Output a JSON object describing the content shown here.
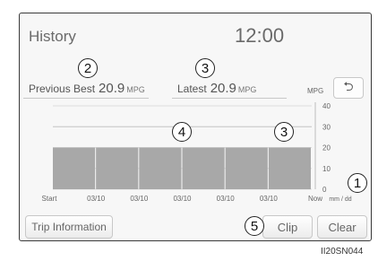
{
  "screen": {
    "title": "History",
    "clock": "12:00"
  },
  "stats": {
    "previous_best": {
      "label": "Previous Best",
      "value": "20.9",
      "unit": "MPG"
    },
    "latest": {
      "label": "Latest",
      "value": "20.9",
      "unit": "MPG"
    }
  },
  "chart_data": {
    "type": "bar",
    "categories": [
      "03/10",
      "03/10",
      "03/10",
      "03/10",
      "03/10"
    ],
    "values": [
      20,
      20,
      20,
      20,
      20,
      20
    ],
    "start_label": "Start",
    "end_label": "Now",
    "xlabel": "mm / dd",
    "ylabel": "MPG",
    "yticks": [
      0,
      10,
      20,
      30,
      40
    ],
    "ylim": [
      0,
      40
    ],
    "bar_color": "#a8a8a8",
    "guide_value": 30
  },
  "buttons": {
    "back_icon": "return-arrow-icon",
    "trip_info": "Trip Information",
    "clip": "Clip",
    "clear": "Clear"
  },
  "callouts": [
    "1",
    "2",
    "3",
    "3",
    "4",
    "5"
  ],
  "figure_id": "II20SN044"
}
